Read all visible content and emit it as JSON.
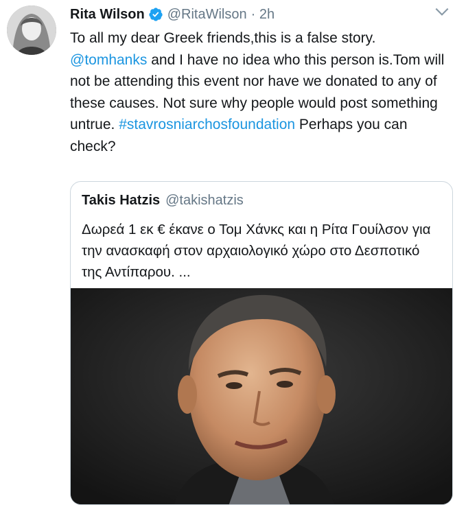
{
  "tweet": {
    "author_name": "Rita Wilson",
    "author_handle": "@RitaWilson",
    "timestamp": "· 2h",
    "text_1": "To all my dear Greek friends,this is a false story. ",
    "mention": "@tomhanks",
    "text_2": " and I have no idea who this person is.Tom will not be attending this event nor have we donated to any of these causes. Not sure why people would post something untrue. ",
    "hashtag": "#stavrosniarchosfoundation",
    "text_3": " Perhaps you can check?"
  },
  "quoted_tweet": {
    "author_name": "Takis Hatzis",
    "author_handle": "@takishatzis",
    "text": "Δωρεά 1 εκ € έκανε ο Τομ Χάνκς και η Ρίτα Γουίλσον για την ανασκαφή στον αρχαιολογικό χώρο στο Δεσποτικό της Αντίπαρου. ..."
  },
  "colors": {
    "link": "#1b95e0",
    "secondary_text": "#657786",
    "border": "#ccd6dd",
    "verified": "#1da1f2"
  },
  "icons": {
    "verified": "verified-badge-icon",
    "menu": "chevron-down-icon"
  }
}
